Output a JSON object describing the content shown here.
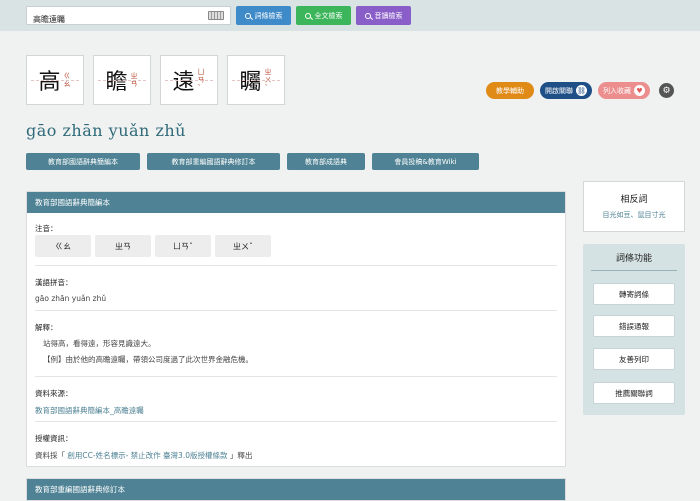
{
  "search": {
    "value": "高瞻遠矚",
    "buttons": [
      "詞條檢索",
      "全文檢索",
      "音讀檢索"
    ]
  },
  "chars": [
    {
      "hanzi": "高",
      "zhuyin": "ㄍㄠ"
    },
    {
      "hanzi": "瞻",
      "zhuyin": "ㄓㄢ"
    },
    {
      "hanzi": "遠",
      "zhuyin": "ㄩㄢˇ"
    },
    {
      "hanzi": "矚",
      "zhuyin": "ㄓㄨˇ"
    }
  ],
  "actions": {
    "assist": "教學輔助",
    "relations": "開啟關聯",
    "collect": "列入收藏"
  },
  "pinyin": "gāo zhān yuǎn zhǔ",
  "tabs": [
    "教育部國語辭典簡編本",
    "教育部重編國語辭典修訂本",
    "教育部成語典",
    "會員投稿&教育Wiki"
  ],
  "panel": {
    "title": "教育部國語辭典簡編本",
    "zhuyin_label": "注音：",
    "zhuyin": [
      "ㄍㄠ",
      "ㄓㄢ",
      "ㄩㄢˇ",
      "ㄓㄨˇ"
    ],
    "pinyin_label": "漢語拼音：",
    "pinyin": "gāo zhān yuǎn zhǔ",
    "definition_label": "解釋：",
    "definition_line1": "站得高，看得遠，形容見識遠大。",
    "definition_line2": "【例】由於他的高瞻遠矚，帶領公司度過了此次世界金融危機。",
    "source_label": "資料來源：",
    "source_link": "教育部國語辭典簡編本_高瞻遠矚",
    "license_label": "授權資訊：",
    "license_prefix": "資料採「",
    "license_link": "創用CC-姓名標示- 禁止改作 臺灣3.0版授權條款",
    "license_suffix": "」釋出"
  },
  "panel2": {
    "title": "教育部重編國語辭典修訂本"
  },
  "sidebar": {
    "antonym_title": "相反詞",
    "antonym_value": "目光如豆、鼠目寸光",
    "functions_title": "詞條功能",
    "functions": [
      "轉寄詞條",
      "錯誤通報",
      "友善列印",
      "推薦關聯詞"
    ]
  }
}
